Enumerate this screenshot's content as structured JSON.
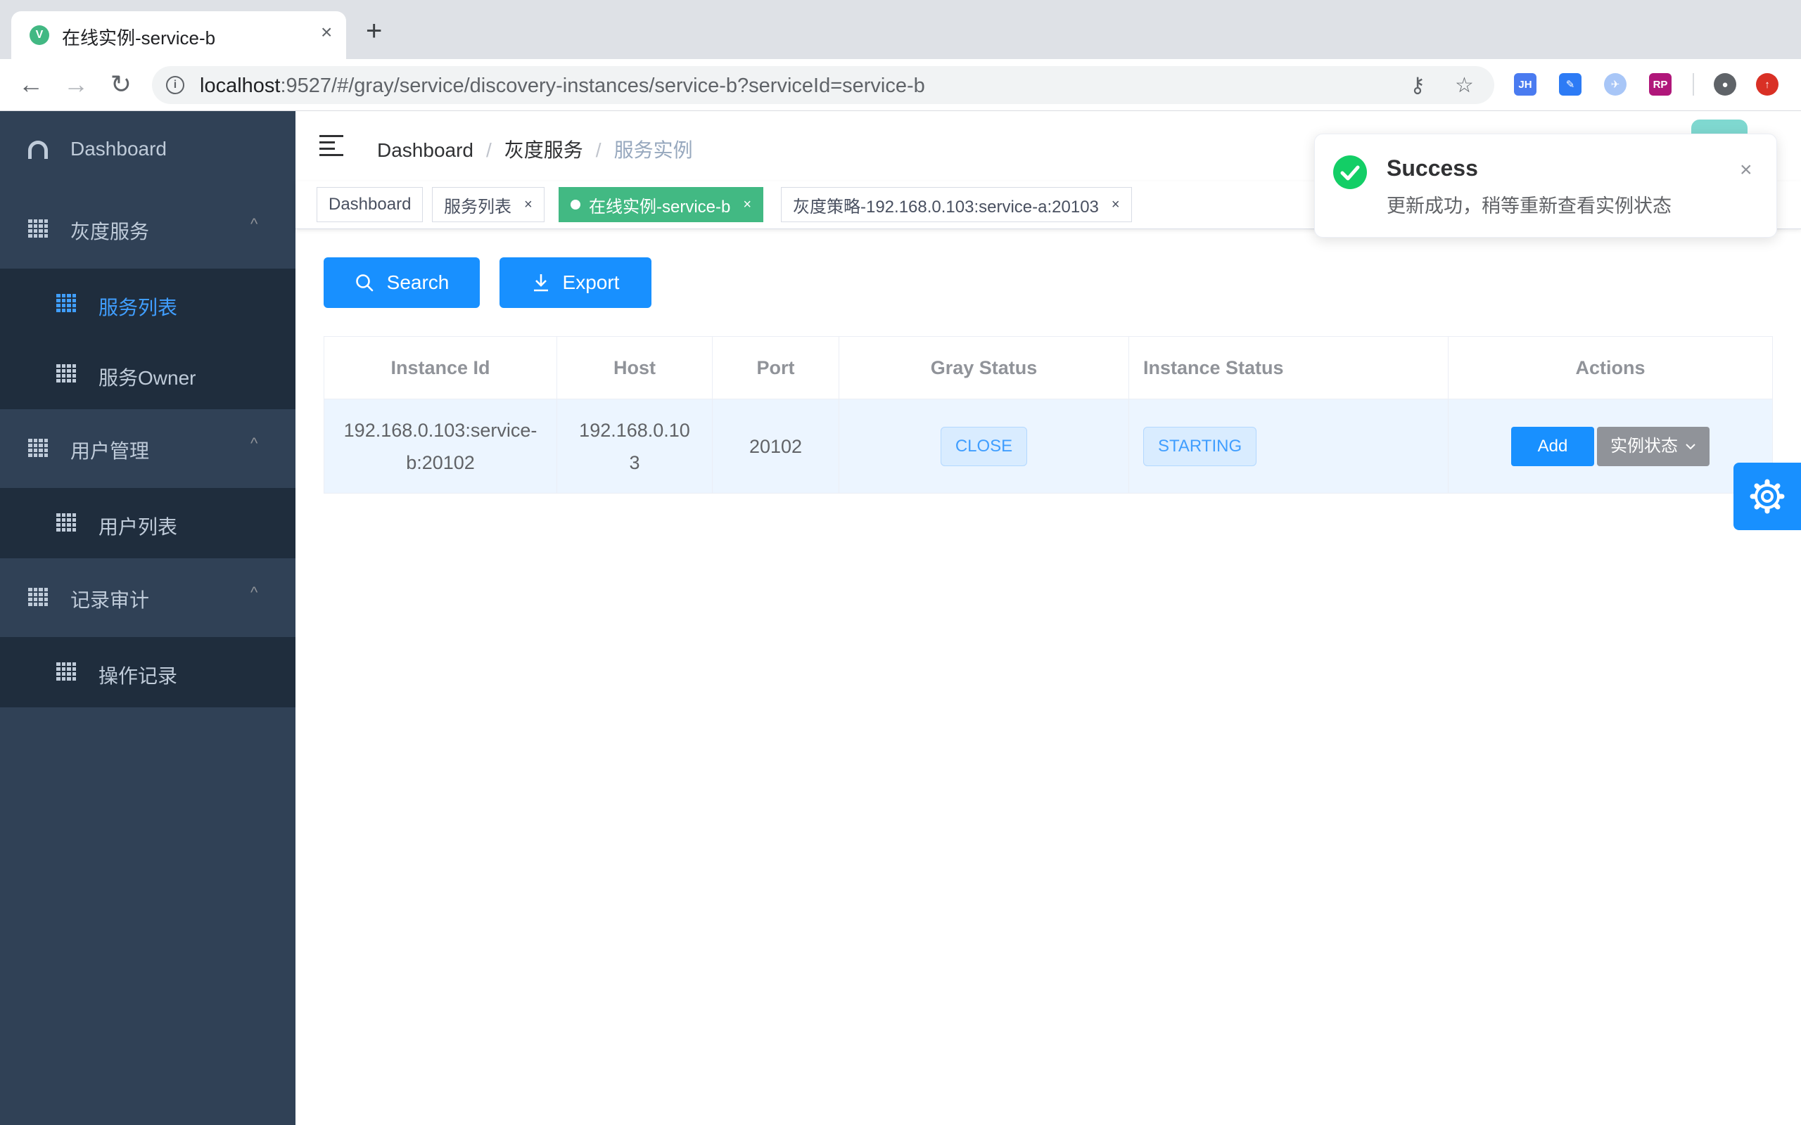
{
  "browser": {
    "tab_title": "在线实例-service-b",
    "favicon_letter": "V",
    "tab_close": "×",
    "new_tab": "+",
    "url_host": "localhost",
    "url_rest": ":9527/#/gray/service/discovery-instances/service-b?serviceId=service-b",
    "extensions": [
      {
        "label": "JH",
        "color": "#4a7bf0"
      },
      {
        "label": "",
        "color": "#2d7bf5"
      },
      {
        "label": "",
        "color": "#a8c6f7"
      },
      {
        "label": "RP",
        "color": "#b0177a"
      }
    ]
  },
  "sidebar": {
    "dashboard": "Dashboard",
    "gray_service": "灰度服务",
    "service_list": "服务列表",
    "service_owner": "服务Owner",
    "user_mgmt": "用户管理",
    "user_list": "用户列表",
    "audit": "记录审计",
    "operation_log": "操作记录",
    "chevron": "^"
  },
  "breadcrumb": {
    "items": [
      "Dashboard",
      "灰度服务",
      "服务实例"
    ],
    "separator": "/"
  },
  "tags": [
    {
      "label": "Dashboard",
      "closable": false,
      "active": false
    },
    {
      "label": "服务列表",
      "closable": true,
      "active": false
    },
    {
      "label": "在线实例-service-b",
      "closable": true,
      "active": true
    },
    {
      "label": "灰度策略-192.168.0.103:service-a:20103",
      "closable": true,
      "active": false
    }
  ],
  "tag_close": "×",
  "buttons": {
    "search": "Search",
    "export": "Export"
  },
  "table": {
    "headers": [
      "Instance Id",
      "Host",
      "Port",
      "Gray Status",
      "Instance Status",
      "Actions"
    ],
    "rows": [
      {
        "instance_id_line1": "192.168.0.103:service-",
        "instance_id_line2": "b:20102",
        "host_line1": "192.168.0.10",
        "host_line2": "3",
        "port": "20102",
        "gray_status": "CLOSE",
        "instance_status": "STARTING",
        "action_add": "Add",
        "action_status": "实例状态"
      }
    ]
  },
  "notification": {
    "title": "Success",
    "message": "更新成功，稍等重新查看实例状态",
    "close": "×"
  },
  "colors": {
    "primary": "#1890ff",
    "tag_active": "#42b983",
    "sidebar_bg": "#304156",
    "submenu_bg": "#1f2d3d",
    "success": "#13ce66"
  }
}
